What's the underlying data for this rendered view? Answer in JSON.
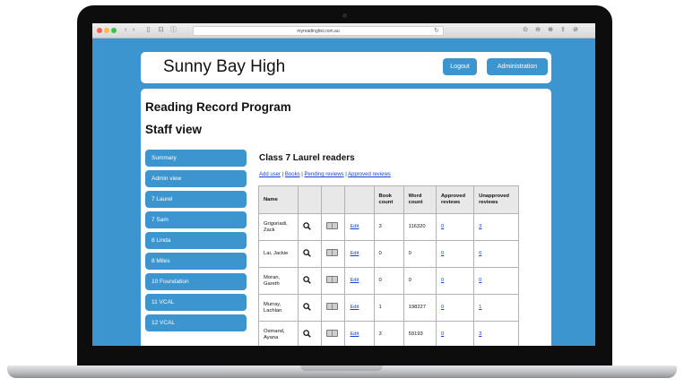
{
  "browser": {
    "url": "myreadinglist.com.au",
    "nav_back": "‹",
    "nav_forward": "›",
    "sidebar_glyph": "▯",
    "share_glyph": "⊡",
    "privacy_glyph": "ⓘ",
    "reload_glyph": "↻",
    "right_icons": [
      "⊙",
      "⊖",
      "⊕",
      "⇧",
      "⊘"
    ]
  },
  "header": {
    "school_name": "Sunny Bay High",
    "logout_label": "Logout",
    "admin_label": "Administration"
  },
  "main": {
    "program_title": "Reading Record Program",
    "view_title": "Staff view",
    "class_title": "Class 7 Laurel readers",
    "links": [
      "Add user",
      "Books",
      "Pending reviews",
      "Approved reviews"
    ],
    "link_separator": " | "
  },
  "sidebar": {
    "items": [
      {
        "label": "Summary"
      },
      {
        "label": "Admin view"
      },
      {
        "label": "7 Laurel"
      },
      {
        "label": "7 Sam"
      },
      {
        "label": "8 Linda"
      },
      {
        "label": "8 Miles"
      },
      {
        "label": "10 Foundation"
      },
      {
        "label": "11 VCAL"
      },
      {
        "label": "12 VCAL"
      }
    ]
  },
  "table": {
    "headers": [
      "Name",
      "",
      "",
      "",
      "Book count",
      "Word count",
      "Approved reviews",
      "Unapproved reviews"
    ],
    "edit_label": "Edit",
    "rows": [
      {
        "name": "Grigoriadi, Zack",
        "book_count": "3",
        "word_count": "116320",
        "approved": "0",
        "unapproved": "3"
      },
      {
        "name": "Lai, Jackie",
        "book_count": "0",
        "word_count": "0",
        "approved": "0",
        "unapproved": "0"
      },
      {
        "name": "Moran, Gareth",
        "book_count": "0",
        "word_count": "0",
        "approved": "0",
        "unapproved": "0"
      },
      {
        "name": "Murray, Lachlan",
        "book_count": "1",
        "word_count": "198227",
        "approved": "0",
        "unapproved": "1"
      },
      {
        "name": "Osmand, Ayana",
        "book_count": "3",
        "word_count": "59193",
        "approved": "0",
        "unapproved": "3"
      }
    ]
  },
  "colors": {
    "accent": "#3d95d0",
    "link": "#1a3fd6"
  }
}
